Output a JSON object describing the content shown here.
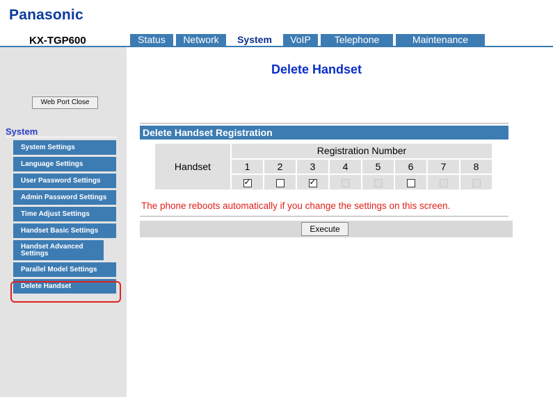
{
  "brand": "Panasonic",
  "model": "KX-TGP600",
  "tabs": [
    {
      "label": "Status"
    },
    {
      "label": "Network"
    },
    {
      "label": "System"
    },
    {
      "label": "VoIP"
    },
    {
      "label": "Telephone"
    },
    {
      "label": "Maintenance"
    }
  ],
  "sidebar": {
    "web_port_close": "Web Port Close",
    "section": "System",
    "items": [
      {
        "label": "System Settings"
      },
      {
        "label": "Language Settings"
      },
      {
        "label": "User Password Settings"
      },
      {
        "label": "Admin Password Settings"
      },
      {
        "label": "Time Adjust Settings"
      },
      {
        "label": "Handset Basic Settings"
      },
      {
        "label": "Handset Advanced Settings"
      },
      {
        "label": "Parallel Model Settings"
      },
      {
        "label": "Delete Handset"
      }
    ]
  },
  "main": {
    "title": "Delete Handset",
    "section_title": "Delete Handset Registration",
    "row_label": "Handset",
    "column_header": "Registration Number",
    "registrations": [
      {
        "number": "1",
        "state": "checked"
      },
      {
        "number": "2",
        "state": "unchecked"
      },
      {
        "number": "3",
        "state": "checked"
      },
      {
        "number": "4",
        "state": "disabled"
      },
      {
        "number": "5",
        "state": "disabled"
      },
      {
        "number": "6",
        "state": "unchecked"
      },
      {
        "number": "7",
        "state": "disabled"
      },
      {
        "number": "8",
        "state": "disabled"
      }
    ],
    "warning": "The phone reboots automatically if you change the settings on this screen.",
    "execute_label": "Execute"
  },
  "colors": {
    "accent": "#3d7cb3",
    "title": "#0b2ec9",
    "warning": "#e0201a",
    "highlight": "#e02020"
  }
}
